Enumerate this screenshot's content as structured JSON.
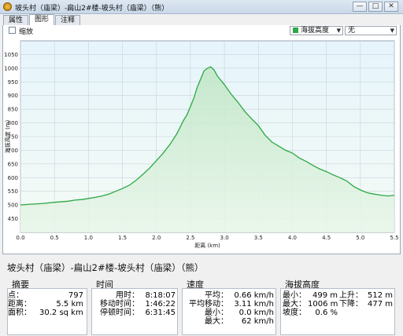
{
  "window": {
    "title": "坡头村（庙梁）-扁山2#楼-坡头村（庙梁）（熊）",
    "buttons": [
      "—",
      "□",
      "✕"
    ]
  },
  "tabs": [
    {
      "label": "属性",
      "active": false
    },
    {
      "label": "图形",
      "active": true
    },
    {
      "label": "注释",
      "active": false
    }
  ],
  "toolbar": {
    "zoom_label": "缩放",
    "series_select": "海拔高度",
    "series_color": "#2ca845",
    "second_select": "无"
  },
  "chart_data": {
    "type": "area",
    "xlabel": "距离 (km)",
    "ylabel": "海拔高度 (m)",
    "xlim": [
      0.0,
      5.5
    ],
    "ylim": [
      400,
      1100
    ],
    "xticks": [
      "0.0",
      "0.5",
      "1.0",
      "1.5",
      "2.0",
      "2.5",
      "3.0",
      "3.5",
      "4.0",
      "4.5",
      "5.0",
      "5.5"
    ],
    "yticks": [
      "450",
      "500",
      "550",
      "600",
      "650",
      "700",
      "750",
      "800",
      "850",
      "900",
      "950",
      "1000",
      "1050"
    ],
    "grid": true,
    "series": [
      {
        "x": [
          0.0,
          0.1,
          0.3,
          0.5,
          0.7,
          0.8,
          0.9,
          1.0,
          1.1,
          1.2,
          1.3,
          1.4,
          1.5,
          1.6,
          1.7,
          1.8,
          1.9,
          2.0,
          2.1,
          2.2,
          2.3,
          2.4,
          2.45,
          2.5,
          2.55,
          2.6,
          2.65,
          2.7,
          2.75,
          2.8,
          2.85,
          2.9,
          3.0,
          3.1,
          3.2,
          3.3,
          3.4,
          3.5,
          3.6,
          3.7,
          3.8,
          3.9,
          4.0,
          4.1,
          4.2,
          4.3,
          4.4,
          4.5,
          4.6,
          4.7,
          4.8,
          4.9,
          5.0,
          5.1,
          5.2,
          5.3,
          5.4,
          5.5
        ],
        "values": [
          500,
          502,
          505,
          510,
          514,
          518,
          520,
          524,
          528,
          533,
          540,
          550,
          560,
          572,
          590,
          612,
          635,
          662,
          690,
          722,
          760,
          810,
          830,
          860,
          890,
          930,
          960,
          990,
          1000,
          1005,
          993,
          970,
          940,
          905,
          875,
          842,
          815,
          790,
          755,
          730,
          715,
          700,
          690,
          672,
          660,
          645,
          632,
          622,
          610,
          600,
          588,
          568,
          555,
          545,
          540,
          536,
          533,
          535
        ]
      }
    ]
  },
  "info": {
    "title": "坡头村（庙梁）-扁山2#楼-坡头村（庙梁）（熊）",
    "summary": {
      "title": "摘要",
      "rows": [
        {
          "label": "点：",
          "value": "797"
        },
        {
          "label": "距离：",
          "value": "5.5 km"
        },
        {
          "label": "面积：",
          "value": "30.2 sq km"
        }
      ]
    },
    "time": {
      "title": "时间",
      "rows": [
        {
          "label": "用时：",
          "value": "8:18:07"
        },
        {
          "label": "移动时间：",
          "value": "1:46:22"
        },
        {
          "label": "停顿时间：",
          "value": "6:31:45"
        }
      ]
    },
    "speed": {
      "title": "速度",
      "rows": [
        {
          "label": "平均：",
          "value": "0.66 km/h"
        },
        {
          "label": "平均移动：",
          "value": "3.11 km/h"
        },
        {
          "label": "最小：",
          "value": "0.0 km/h"
        },
        {
          "label": "最大：",
          "value": "62 km/h"
        }
      ]
    },
    "elevation": {
      "title": "海拔高度",
      "rows": [
        {
          "label": "最小：",
          "value": "499 m"
        },
        {
          "label": "最大：",
          "value": "1006 m"
        },
        {
          "label": "坡度：",
          "value": "0.6 %"
        }
      ],
      "rows2": [
        {
          "label": "上升：",
          "value": "512 m"
        },
        {
          "label": "下降：",
          "value": "477 m"
        }
      ]
    }
  }
}
